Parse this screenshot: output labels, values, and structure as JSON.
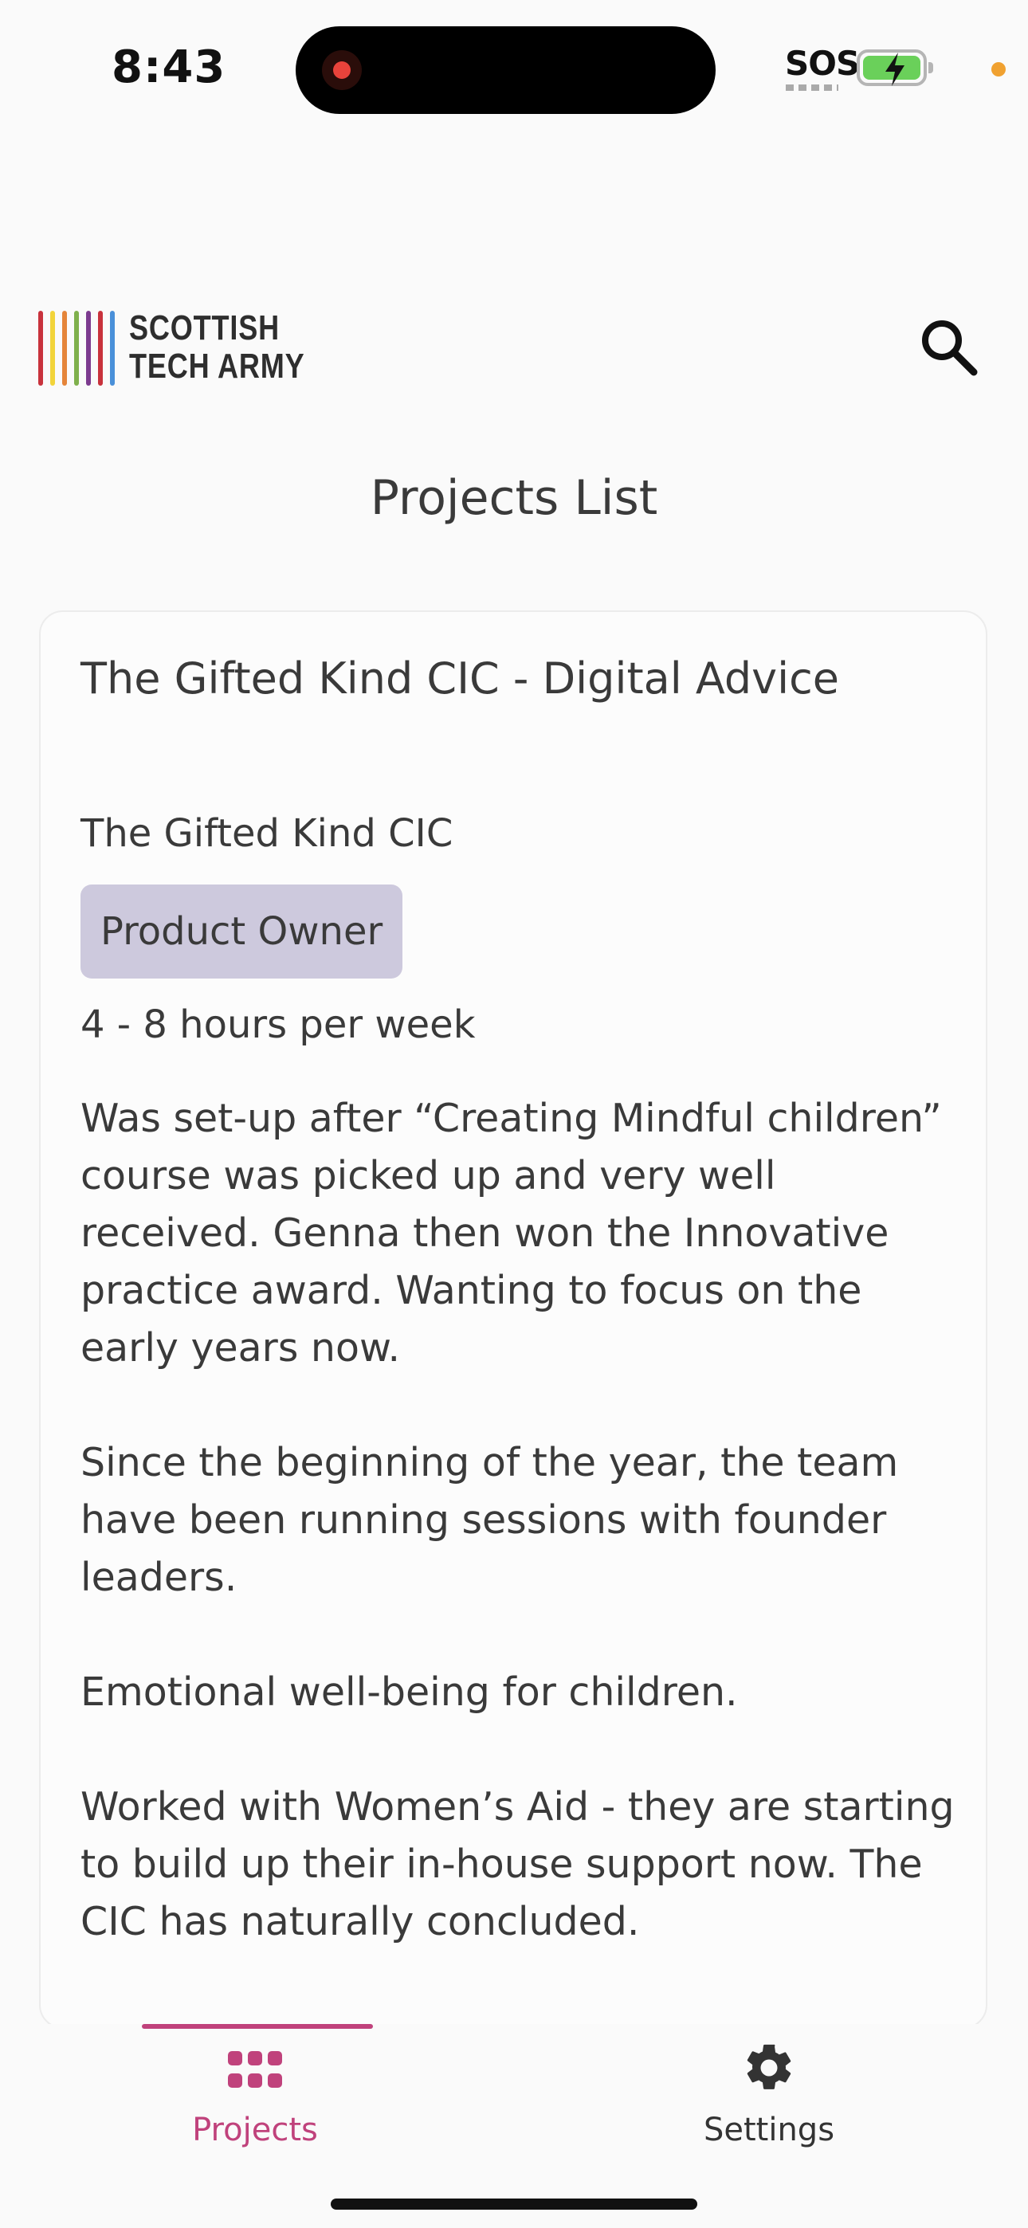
{
  "status_bar": {
    "time": "8:43",
    "carrier_text": "SOS",
    "battery_state": "charging",
    "battery_color": "#6ad05a"
  },
  "header": {
    "logo_text_line1": "SCOTTISH",
    "logo_text_line2": "TECH ARMY",
    "logo_bar_colors": [
      "#c8323c",
      "#f2d43a",
      "#e5853a",
      "#7fb04c",
      "#7c3b8f",
      "#c8323c",
      "#4a90d9"
    ],
    "search_icon": "search-icon"
  },
  "page": {
    "title": "Projects List"
  },
  "project": {
    "title": "The Gifted Kind CIC - Digital Advice",
    "organisation": "The Gifted Kind CIC",
    "role": "Product Owner",
    "hours": "4 - 8 hours per week",
    "description": [
      "Was set-up after “Creating Mindful children” course was picked up and very well received.  Genna then won the Innovative practice award.  Wanting to focus on the early years now.",
      "Since the beginning of the year, the team have been running sessions with founder leaders.",
      "Emotional well-being for children.",
      "Worked with Women’s Aid - they are starting to build up their in-house support now.  The CIC has naturally concluded."
    ]
  },
  "tabbar": {
    "tabs": [
      {
        "label": "Projects",
        "icon": "grid-icon",
        "active": true
      },
      {
        "label": "Settings",
        "icon": "gear-icon",
        "active": false
      }
    ],
    "accent_color": "#c0427c"
  }
}
